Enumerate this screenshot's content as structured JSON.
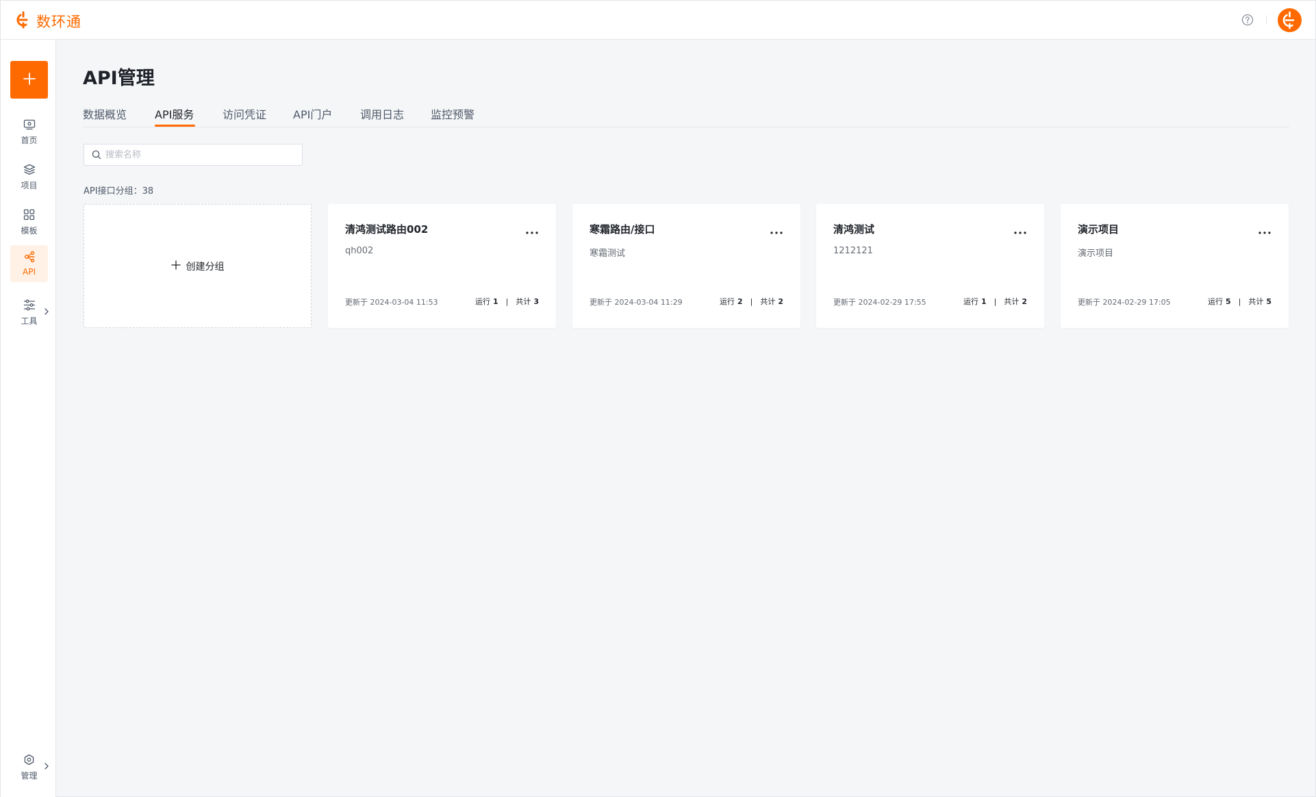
{
  "brand": {
    "name": "数环通",
    "accent": "#ff6a00"
  },
  "header": {
    "help_icon": "help-circle-icon",
    "avatar_icon": "brand-logo-icon"
  },
  "sidebar": {
    "add_button": "plus-icon",
    "items": [
      {
        "key": "home",
        "label": "首页",
        "icon": "monitor-icon",
        "active": false
      },
      {
        "key": "project",
        "label": "项目",
        "icon": "layers-icon",
        "active": false
      },
      {
        "key": "template",
        "label": "模板",
        "icon": "grid-icon",
        "active": false
      },
      {
        "key": "api",
        "label": "API",
        "icon": "api-icon",
        "active": true
      },
      {
        "key": "tools",
        "label": "工具",
        "icon": "sliders-icon",
        "active": false,
        "has_submenu": true
      }
    ],
    "bottom": {
      "label": "管理",
      "icon": "gear-icon",
      "has_submenu": true
    }
  },
  "main": {
    "title": "API管理",
    "tabs": [
      {
        "label": "数据概览",
        "active": false
      },
      {
        "label": "API服务",
        "active": true
      },
      {
        "label": "访问凭证",
        "active": false
      },
      {
        "label": "API门户",
        "active": false
      },
      {
        "label": "调用日志",
        "active": false
      },
      {
        "label": "监控预警",
        "active": false
      }
    ],
    "search": {
      "placeholder": "搜索名称",
      "value": ""
    },
    "group_count_label": "API接口分组：",
    "group_count": "38",
    "create_label": "创建分组",
    "cards": [
      {
        "title": "清鸿测试路由002",
        "desc": "qh002",
        "updated": "更新于 2024-03-04 11:53",
        "running_label": "运行",
        "running": "1",
        "total_label": "共计",
        "total": "3"
      },
      {
        "title": "寒霜路由/接口",
        "desc": "寒霜测试",
        "updated": "更新于 2024-03-04 11:29",
        "running_label": "运行",
        "running": "2",
        "total_label": "共计",
        "total": "2"
      },
      {
        "title": "清鸿测试",
        "desc": "1212121",
        "updated": "更新于 2024-02-29 17:55",
        "running_label": "运行",
        "running": "1",
        "total_label": "共计",
        "total": "2"
      },
      {
        "title": "演示项目",
        "desc": "演示项目",
        "updated": "更新于 2024-02-29 17:05",
        "running_label": "运行",
        "running": "5",
        "total_label": "共计",
        "total": "5"
      }
    ]
  }
}
